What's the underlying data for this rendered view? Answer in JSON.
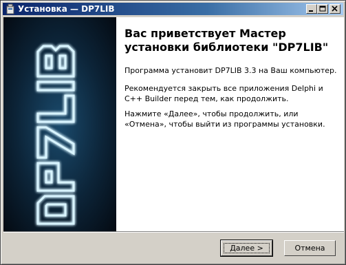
{
  "window": {
    "title": "Установка — DP7LIB"
  },
  "wizard": {
    "heading": "Вас приветствует Мастер установки библиотеки \"DP7LIB\"",
    "paragraphs": [
      "Программа установит DP7LIB 3.3 на Ваш компьютер.",
      "Рекомендуется закрыть все приложения Delphi и C++ Builder перед тем, как продолжить.",
      "Нажмите «Далее», чтобы продолжить, или «Отмена», чтобы выйти из программы установки."
    ],
    "logo_text": "DP7LIB"
  },
  "buttons": {
    "next": "Далее >",
    "cancel": "Отмена"
  },
  "colors": {
    "titlebar_start": "#0a246a",
    "titlebar_end": "#a6caf0",
    "logo_glow": "#7fd4ff"
  },
  "icons": [
    "installer-icon",
    "minimize-icon",
    "maximize-icon",
    "close-icon"
  ]
}
